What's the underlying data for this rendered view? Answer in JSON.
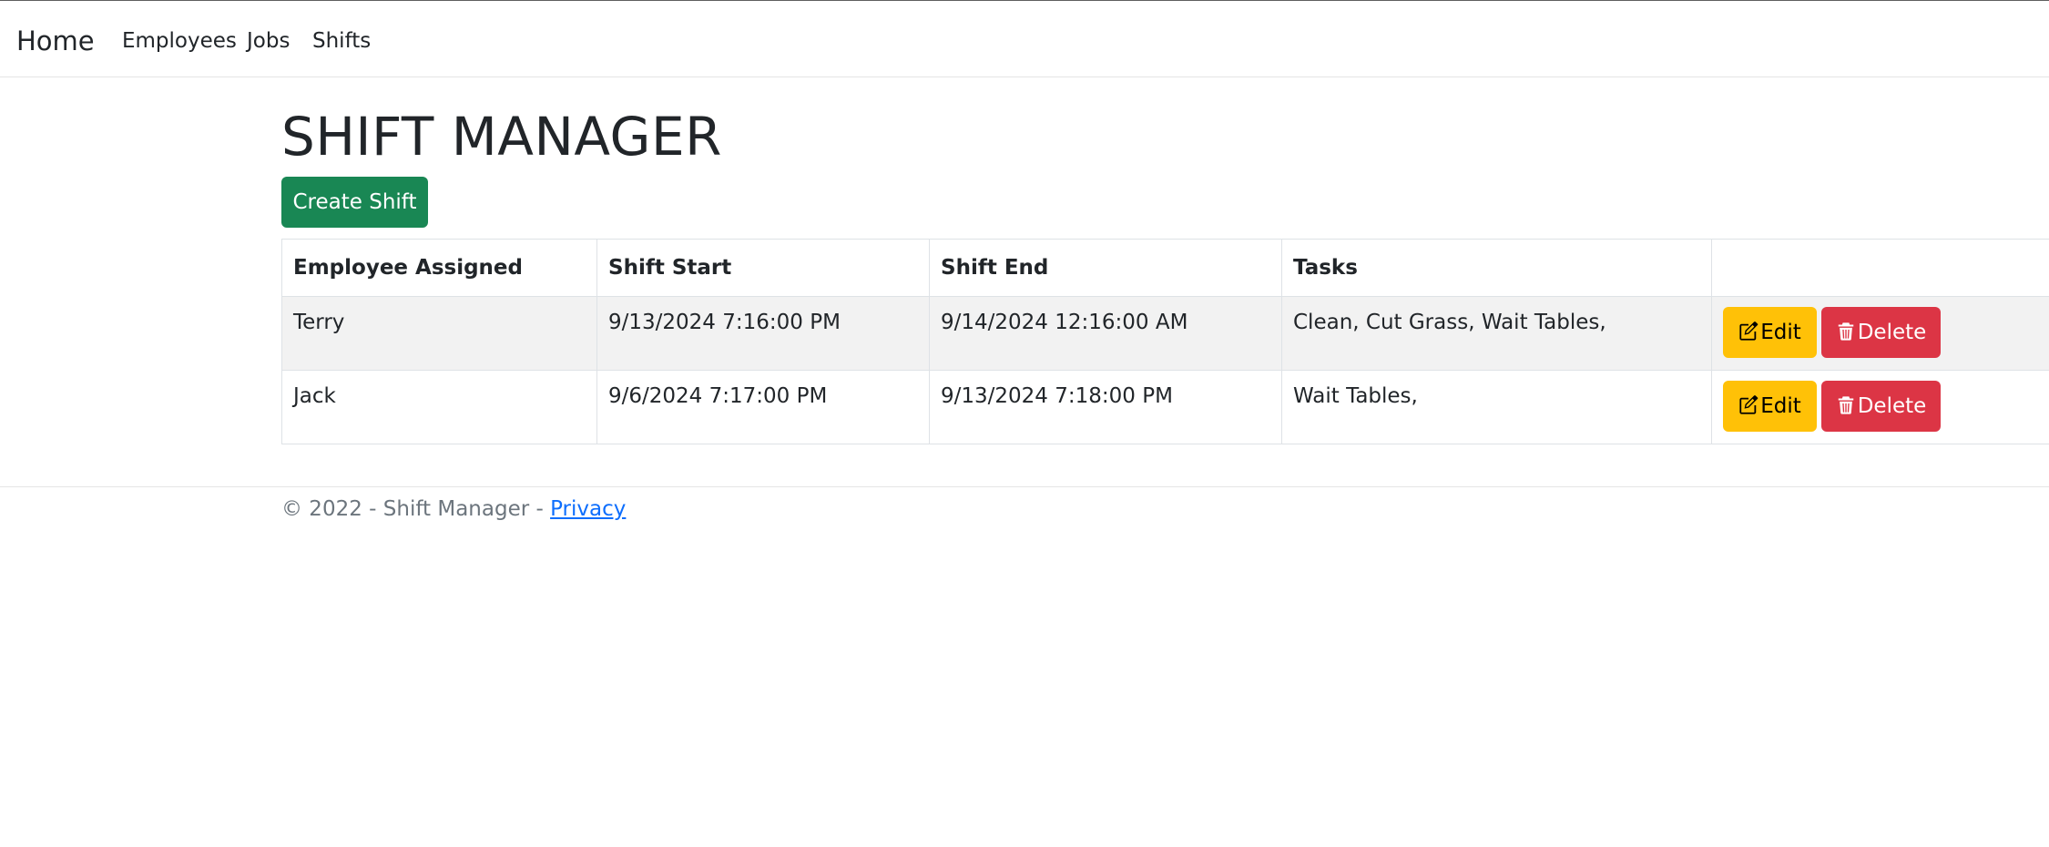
{
  "nav": {
    "brand": "Home",
    "links": [
      "Employees",
      "Jobs",
      "Shifts"
    ]
  },
  "page": {
    "title": "SHIFT MANAGER",
    "create_label": "Create Shift"
  },
  "table": {
    "headers": [
      "Employee Assigned",
      "Shift Start",
      "Shift End",
      "Tasks",
      ""
    ],
    "rows": [
      {
        "employee": "Terry",
        "start": "9/13/2024 7:16:00 PM",
        "end": "9/14/2024 12:16:00 AM",
        "tasks": "Clean, Cut Grass, Wait Tables,"
      },
      {
        "employee": "Jack",
        "start": "9/6/2024 7:17:00 PM",
        "end": "9/13/2024 7:18:00 PM",
        "tasks": "Wait Tables,"
      }
    ],
    "edit_label": "Edit",
    "delete_label": "Delete"
  },
  "footer": {
    "text": "© 2022 - Shift Manager - ",
    "privacy": "Privacy"
  },
  "colors": {
    "create": "#198754",
    "edit": "#ffc107",
    "delete": "#dc3545",
    "link": "#0d6efd"
  },
  "icons": {
    "edit": "pencil-square-icon",
    "delete": "trash-icon"
  }
}
